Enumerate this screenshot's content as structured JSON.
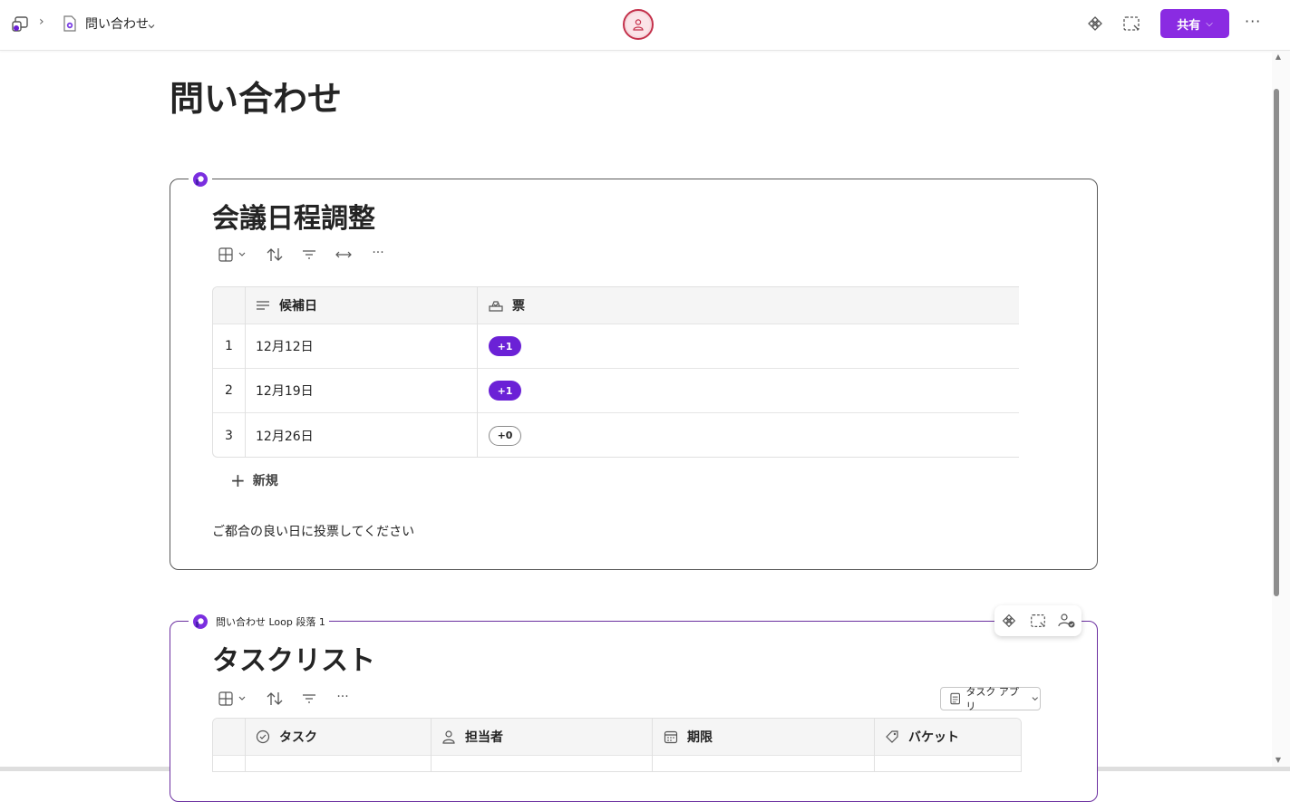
{
  "topbar": {
    "breadcrumb_separator": "›",
    "page_name": "問い合わせ",
    "share_label": "共有",
    "more_label": "···"
  },
  "page": {
    "title": "問い合わせ"
  },
  "schedule_card": {
    "title": "会議日程調整",
    "toolbar_more": "···",
    "columns": [
      "候補日",
      "票"
    ],
    "rows": [
      {
        "num": "1",
        "date": "12月12日",
        "vote": "+1",
        "voted": true
      },
      {
        "num": "2",
        "date": "12月19日",
        "vote": "+1",
        "voted": true
      },
      {
        "num": "3",
        "date": "12月26日",
        "vote": "+0",
        "voted": false
      }
    ],
    "new_label": "新規",
    "note": "ご都合の良い日に投票してください"
  },
  "task_card": {
    "component_label": "問い合わせ Loop 段落 1",
    "title": "タスクリスト",
    "toolbar_more": "···",
    "task_app_label": "タスク アプリ",
    "columns": [
      "タスク",
      "担当者",
      "期限",
      "バケット"
    ]
  },
  "colors": {
    "accent": "#8a2be2",
    "vote": "#6b21d6",
    "presence_ring": "#c4314b"
  }
}
